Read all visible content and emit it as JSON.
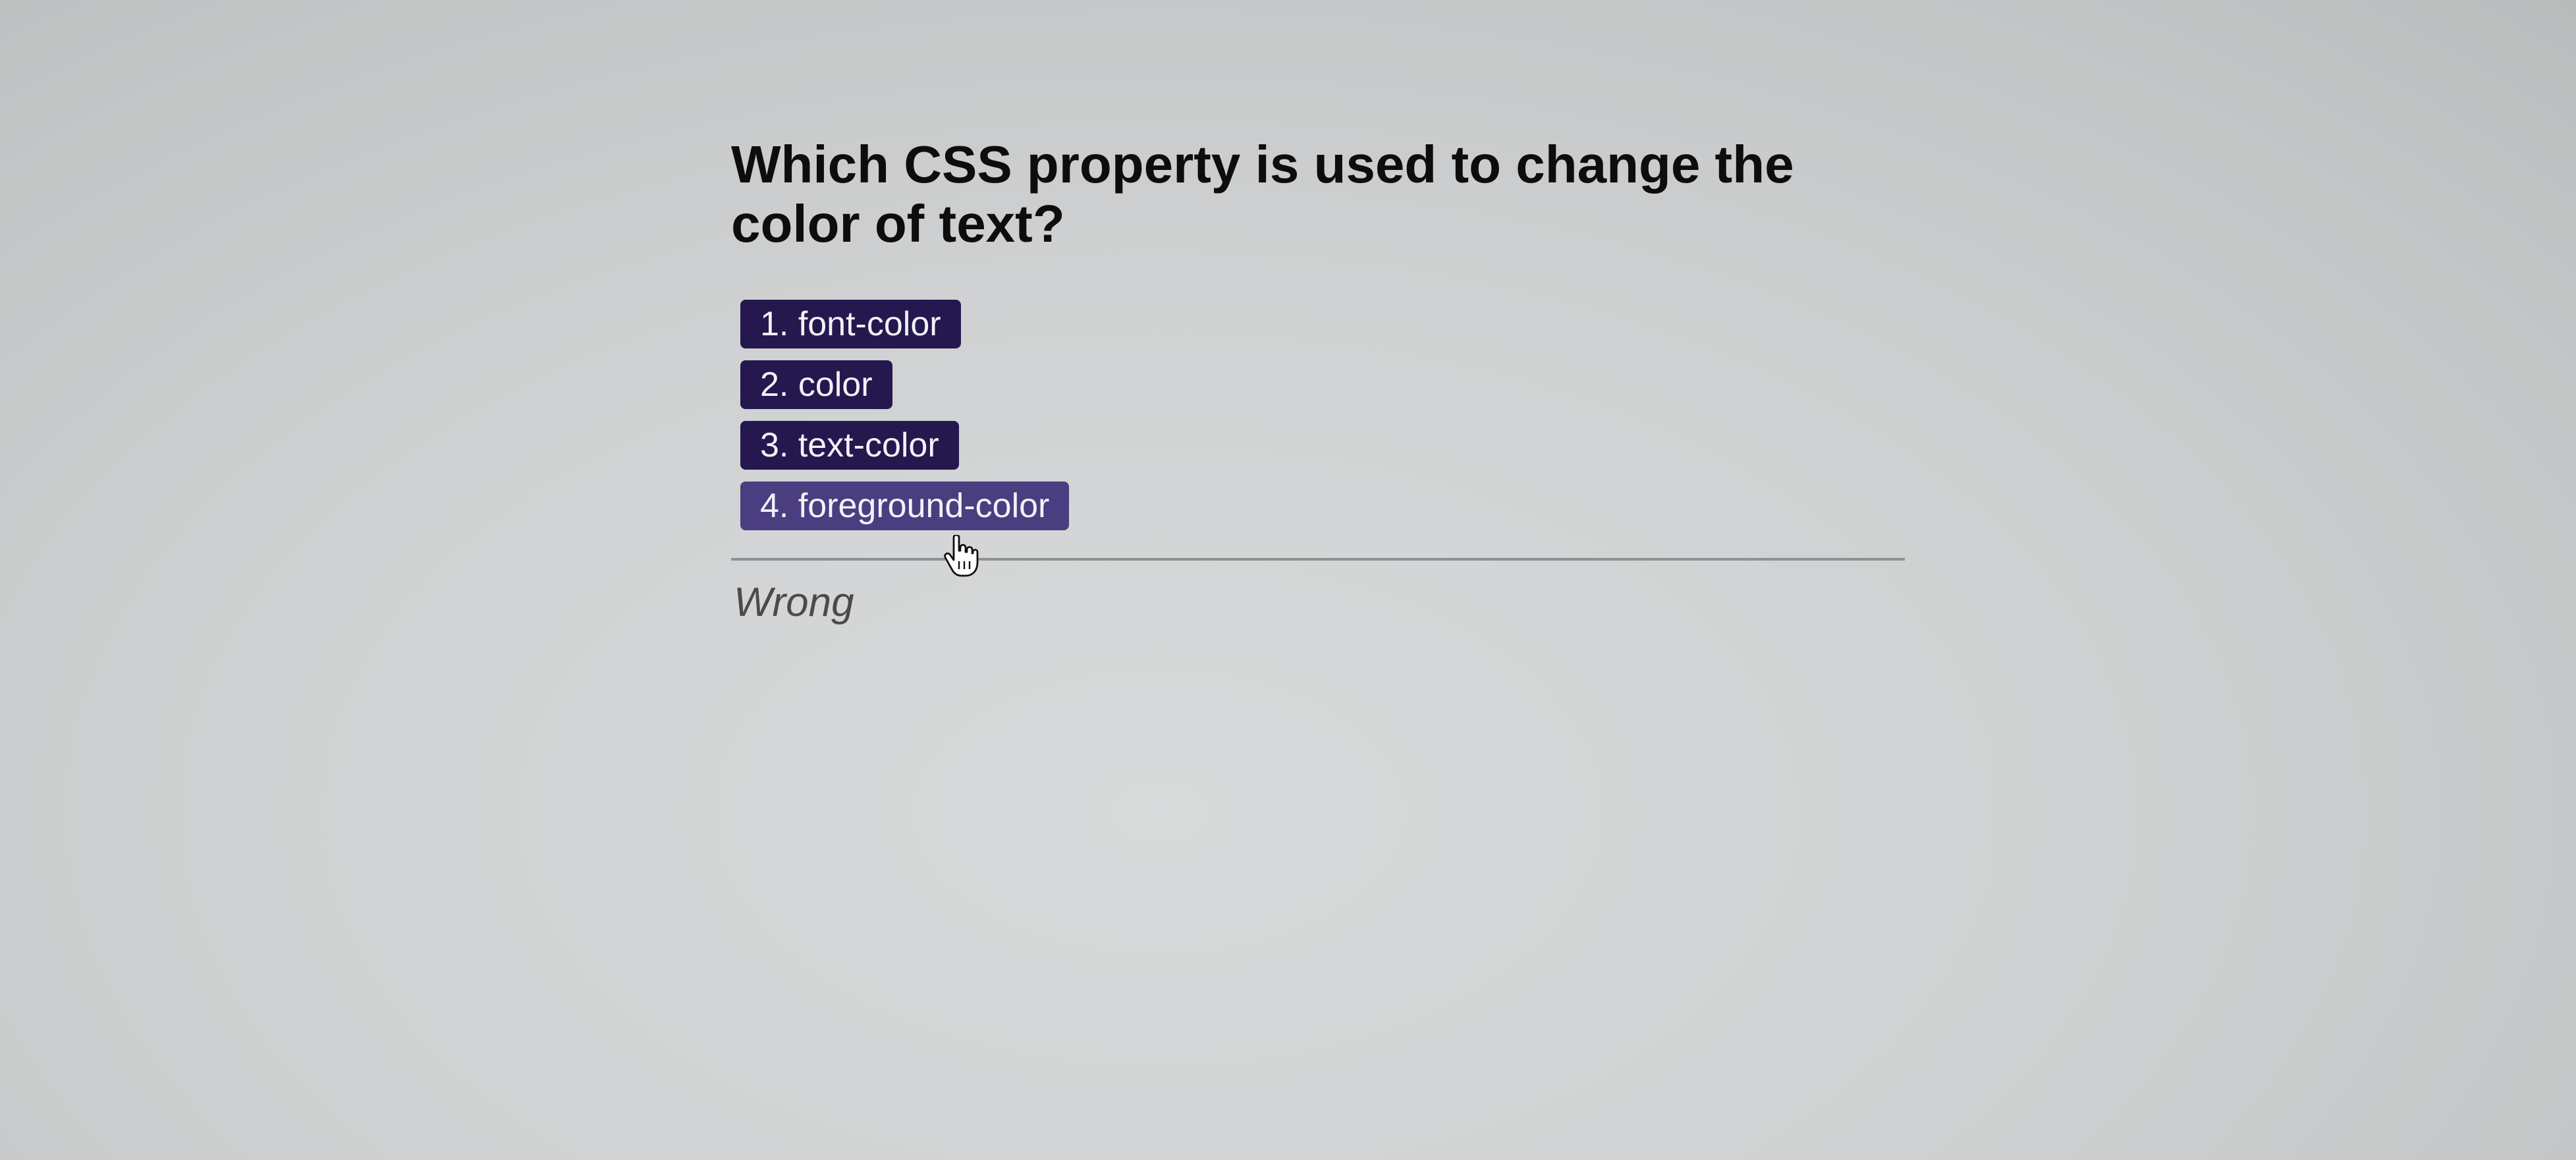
{
  "quiz": {
    "question": "Which CSS property is used to change the color of text?",
    "choices": [
      {
        "label": "1. font-color"
      },
      {
        "label": "2. color"
      },
      {
        "label": "3. text-color"
      },
      {
        "label": "4. foreground-color"
      }
    ],
    "result": "Wrong"
  },
  "colors": {
    "button": "#24184f",
    "button_hover": "#4a3d80",
    "button_text": "#f2f2f7",
    "divider": "#8f9091",
    "result_text": "#4a4a4a"
  },
  "icons": {
    "cursor": "hand-pointer-icon"
  }
}
